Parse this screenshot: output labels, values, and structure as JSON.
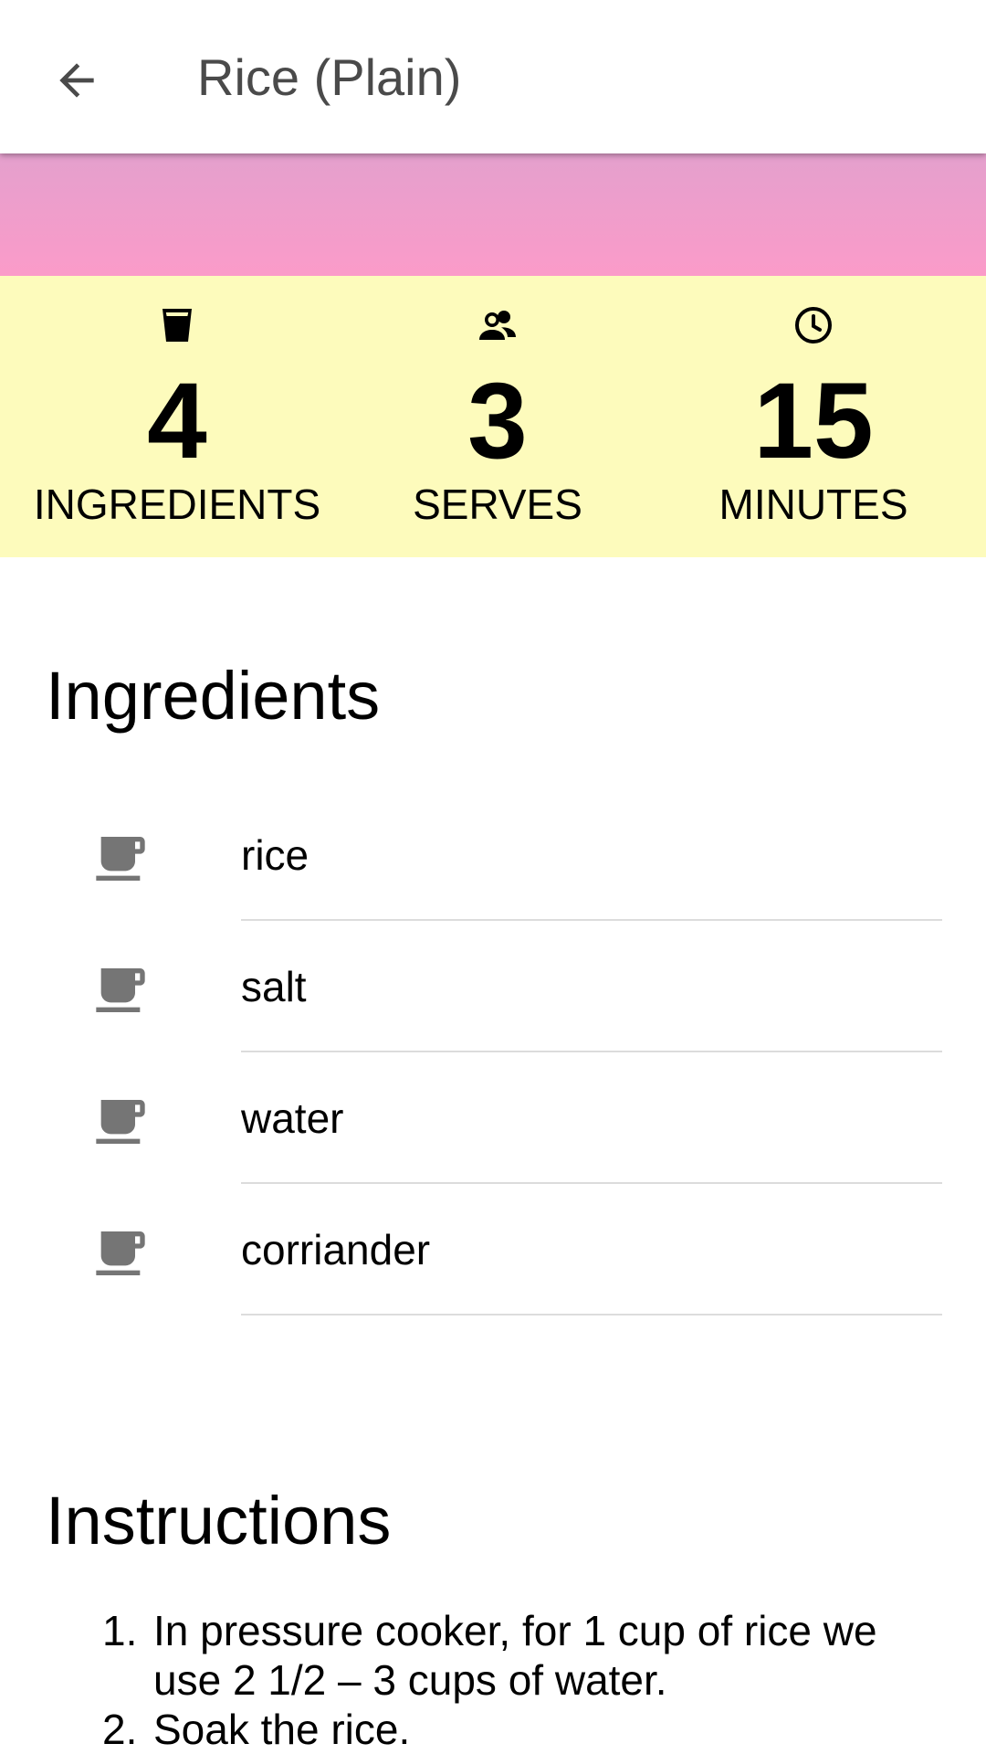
{
  "app_bar": {
    "back_icon": "arrow-left-icon",
    "title": "Rice (Plain)"
  },
  "colors": {
    "hero_gradient_top": "#e4a0cd",
    "hero_gradient_bottom": "#fb9bc9",
    "stats_background": "#fdfbbc",
    "icon_gray": "#757575",
    "divider": "#dcdcdc"
  },
  "stats": [
    {
      "icon": "glass-icon",
      "value": "4",
      "label": "INGREDIENTS"
    },
    {
      "icon": "people-icon",
      "value": "3",
      "label": "SERVES"
    },
    {
      "icon": "clock-icon",
      "value": "15",
      "label": "MINUTES"
    }
  ],
  "ingredients": {
    "title": "Ingredients",
    "item_icon": "coffee-cup-icon",
    "items": [
      "rice",
      "salt",
      "water",
      "corriander"
    ]
  },
  "instructions": {
    "title": "Instructions",
    "steps": [
      {
        "num": "1.",
        "text": "In pressure cooker, for 1 cup of rice we use 2 1/2 – 3 cups of water."
      },
      {
        "num": "2.",
        "text": "Soak the rice."
      }
    ]
  }
}
